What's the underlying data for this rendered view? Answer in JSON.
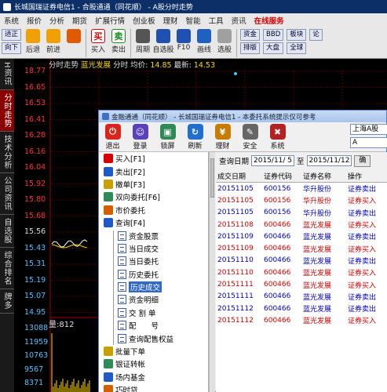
{
  "window": {
    "title": "长城国瑞证券电信1 - 合股通通（同花顺） - A股分时走势"
  },
  "menu": [
    "系统",
    "报价",
    "分析",
    "期货",
    "扩展行情",
    "创业板",
    "理财",
    "智能",
    "工具",
    "资讯",
    "在线服务"
  ],
  "toolbar": {
    "buttons": [
      {
        "label": "后退",
        "icon": "up-arrow-icon"
      },
      {
        "label": "前进",
        "icon": "down-arrow-icon"
      },
      {
        "label": "",
        "icon": "power-icon"
      },
      {
        "label": "买入",
        "icon": "buy-icon",
        "glyph": "买"
      },
      {
        "label": "卖出",
        "icon": "sell-icon",
        "glyph": "卖"
      },
      {
        "label": "周期",
        "icon": "period-icon"
      },
      {
        "label": "自选股",
        "icon": "star-icon"
      },
      {
        "label": "F10",
        "icon": "f10-icon"
      },
      {
        "label": "画线",
        "icon": "draw-icon"
      },
      {
        "label": "选股",
        "icon": "select-icon"
      }
    ],
    "small_buttons": [
      "资金",
      "排版",
      "BBD",
      "大盘",
      "板块",
      "全球",
      "论"
    ],
    "left_labels": [
      "适正",
      "向下"
    ]
  },
  "left_tabs": [
    "H资讯",
    "分时走势",
    "技术分析",
    "公司资讯",
    "自选股",
    "综合排名",
    "牌多"
  ],
  "chart": {
    "header": {
      "prefix": "分时走势",
      "name": "蓝光发展",
      "mid": "分时 均价:",
      "avg": "14.85",
      "latest_label": "最新:",
      "latest": "14.53"
    },
    "price_labels": [
      "18.77",
      "16.65",
      "16.53",
      "16.41",
      "16.28",
      "16.16",
      "16.04",
      "15.92",
      "15.80",
      "15.68",
      "15.56",
      "15.43",
      "15.31",
      "15.19",
      "15.07",
      "14.95"
    ],
    "volume_labels": [
      "13088",
      "11959",
      "10763",
      "9567",
      "8371",
      "7175"
    ],
    "volume_title": "量:812",
    "colors": {
      "up": "#ff3030",
      "down": "#4fc3ff",
      "grid": "#a00000"
    }
  },
  "dialog": {
    "title": "金融通通（同花顺） - 长城国瑞证券电信1 - 本委托系统提示仅可参考",
    "toolbar": [
      {
        "label": "退出",
        "icon": "exit-icon",
        "color": "#d9261c"
      },
      {
        "label": "登录",
        "icon": "login-icon",
        "color": "#5a3fbf"
      },
      {
        "label": "锁屏",
        "icon": "lock-icon",
        "color": "#2e8b57"
      },
      {
        "label": "刷新",
        "icon": "refresh-icon",
        "color": "#1f6fd0"
      },
      {
        "label": "理财",
        "icon": "finance-icon",
        "color": "#c97a00"
      },
      {
        "label": "安全",
        "icon": "security-icon",
        "color": "#666666"
      },
      {
        "label": "系统",
        "icon": "system-icon",
        "color": "#b22222"
      }
    ],
    "account_label": "上海A股",
    "account_value": "A",
    "tree": [
      {
        "label": "买入[F1]",
        "kind": "folder",
        "color": "#d80000",
        "indent": 0
      },
      {
        "label": "卖出[F2]",
        "kind": "folder",
        "color": "#1e5bc6",
        "indent": 0
      },
      {
        "label": "撤单[F3]",
        "kind": "folder",
        "color": "#c8a000",
        "indent": 0
      },
      {
        "label": "双向委托[F6]",
        "kind": "folder",
        "color": "#2e8b57",
        "indent": 0
      },
      {
        "label": "市价委托",
        "kind": "folder",
        "color": "#d06000",
        "indent": 0
      },
      {
        "label": "查询[F4]",
        "kind": "folder",
        "color": "#1e5bc6",
        "indent": 0
      },
      {
        "label": "资金股票",
        "kind": "doc",
        "indent": 1
      },
      {
        "label": "当日成交",
        "kind": "doc",
        "indent": 1
      },
      {
        "label": "当日委托",
        "kind": "doc",
        "indent": 1
      },
      {
        "label": "历史委托",
        "kind": "doc",
        "indent": 1
      },
      {
        "label": "历史成交",
        "kind": "doc",
        "indent": 1,
        "selected": true
      },
      {
        "label": "资金明细",
        "kind": "doc",
        "indent": 1
      },
      {
        "label": "交 割 单",
        "kind": "doc",
        "indent": 1
      },
      {
        "label": "配　　号",
        "kind": "doc",
        "indent": 1
      },
      {
        "label": "查询配售权益",
        "kind": "doc",
        "indent": 1
      },
      {
        "label": "批量下单",
        "kind": "folder",
        "color": "#c8a000",
        "indent": 0
      },
      {
        "label": "银证转帐",
        "kind": "folder",
        "color": "#2e8b57",
        "indent": 0
      },
      {
        "label": "场内基金",
        "kind": "folder",
        "color": "#1e5bc6",
        "indent": 0
      },
      {
        "label": "巧时贷",
        "kind": "folder",
        "color": "#d06000",
        "indent": 0
      }
    ],
    "query": {
      "label": "查询日期",
      "from": "2015/11/ 5",
      "to_label": "至",
      "to": "2015/11/12",
      "button": "确"
    },
    "table": {
      "headers": [
        "成交日期",
        "证券代码",
        "证券名称",
        "操作"
      ],
      "rows": [
        [
          "20151105",
          "600156",
          "华升股份",
          "证券卖出",
          "sell"
        ],
        [
          "20151105",
          "600156",
          "华升股份",
          "证券买入",
          "buy"
        ],
        [
          "20151105",
          "600156",
          "华升股份",
          "证券卖出",
          "sell"
        ],
        [
          "20151108",
          "600466",
          "蓝光发展",
          "证券买入",
          "buy"
        ],
        [
          "20151109",
          "600466",
          "蓝光发展",
          "证券卖出",
          "sell"
        ],
        [
          "20151109",
          "600466",
          "蓝光发展",
          "证券买入",
          "buy"
        ],
        [
          "20151110",
          "600466",
          "蓝光发展",
          "证券卖出",
          "sell"
        ],
        [
          "20151110",
          "600466",
          "蓝光发展",
          "证券买入",
          "buy"
        ],
        [
          "20151111",
          "600466",
          "蓝光发展",
          "证券买入",
          "buy"
        ],
        [
          "20151111",
          "600466",
          "蓝光发展",
          "证券卖出",
          "sell"
        ],
        [
          "20151112",
          "600466",
          "蓝光发展",
          "证券卖出",
          "sell"
        ],
        [
          "20151112",
          "600466",
          "蓝光发展",
          "证券买入",
          "buy"
        ]
      ]
    }
  }
}
